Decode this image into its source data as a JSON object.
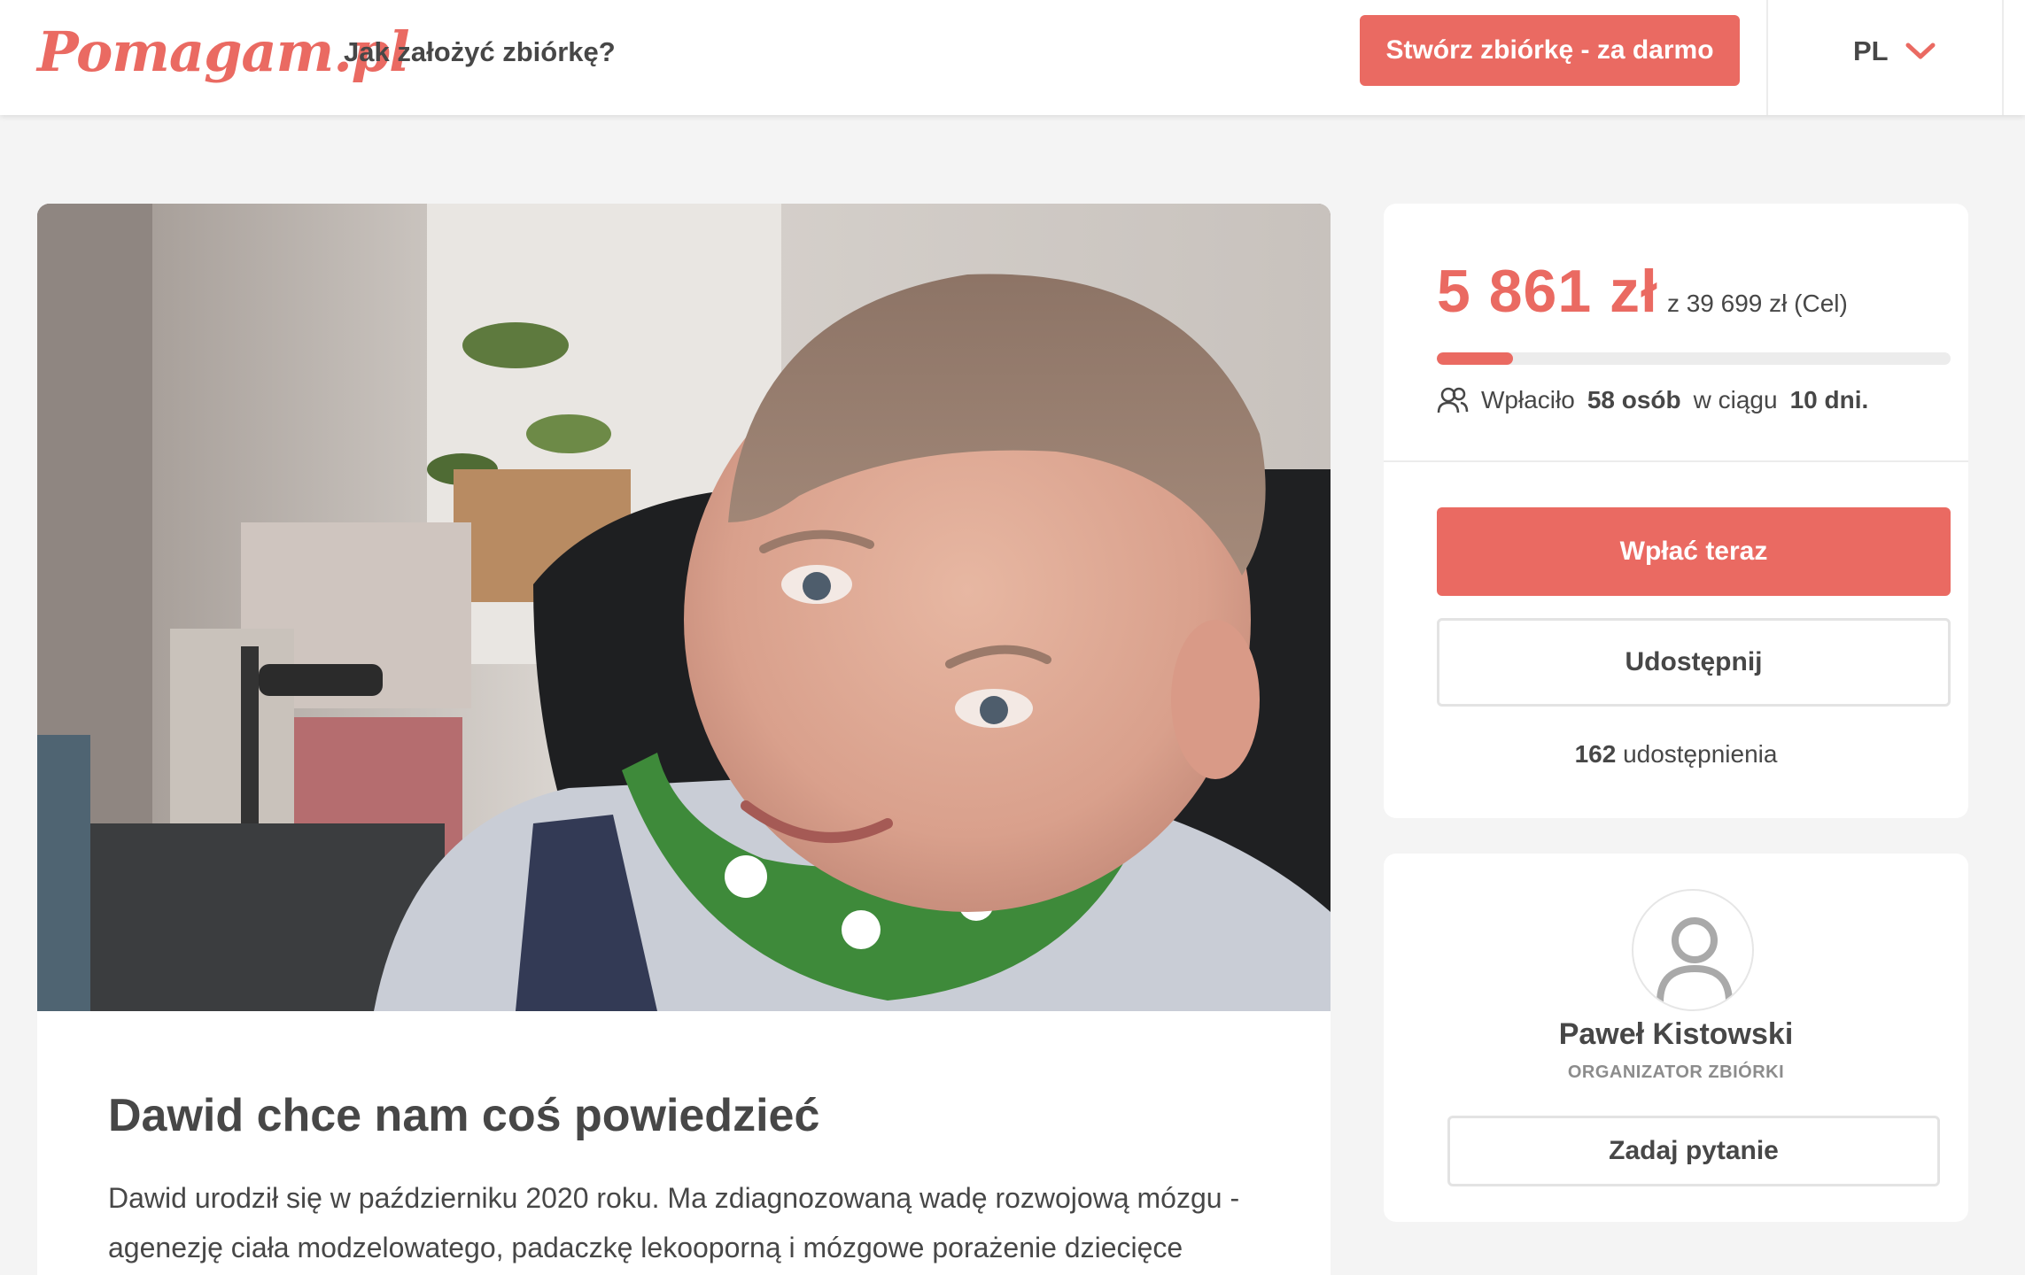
{
  "header": {
    "logo_text": "Pomagam.pl",
    "how_to_link": "Jak założyć zbiórkę?",
    "create_button": "Stwórz zbiórkę - za darmo",
    "language": "PL",
    "language_icon": "chevron-down-icon"
  },
  "campaign": {
    "image_alt": "Dawid",
    "title": "Dawid chce nam coś powiedzieć",
    "description": "Dawid urodził się w październiku 2020 roku. Ma zdiagnozowaną wadę rozwojową mózgu - agenezję ciała modzelowatego, padaczkę lekooporną i mózgowe porażenie dziecięce"
  },
  "donation": {
    "raised": "5 861 zł",
    "goal": "z 39 699 zł (Cel)",
    "progress_fraction": 0.148,
    "donors_prefix": "Wpłaciło",
    "donors_count": "58 osób",
    "donors_middle": "w ciągu",
    "donors_days": "10 dni.",
    "donors_icon": "users-icon",
    "pay_button": "Wpłać teraz",
    "share_button": "Udostępnij",
    "shares_number": "162",
    "shares_label": "udostępnienia"
  },
  "organizer": {
    "avatar_icon": "user-avatar-icon",
    "name": "Paweł Kistowski",
    "role": "ORGANIZATOR ZBIÓRKI",
    "ask_button": "Zadaj pytanie"
  },
  "colors": {
    "accent": "#ea6a62",
    "text": "#474747",
    "background": "#f4f4f4"
  }
}
